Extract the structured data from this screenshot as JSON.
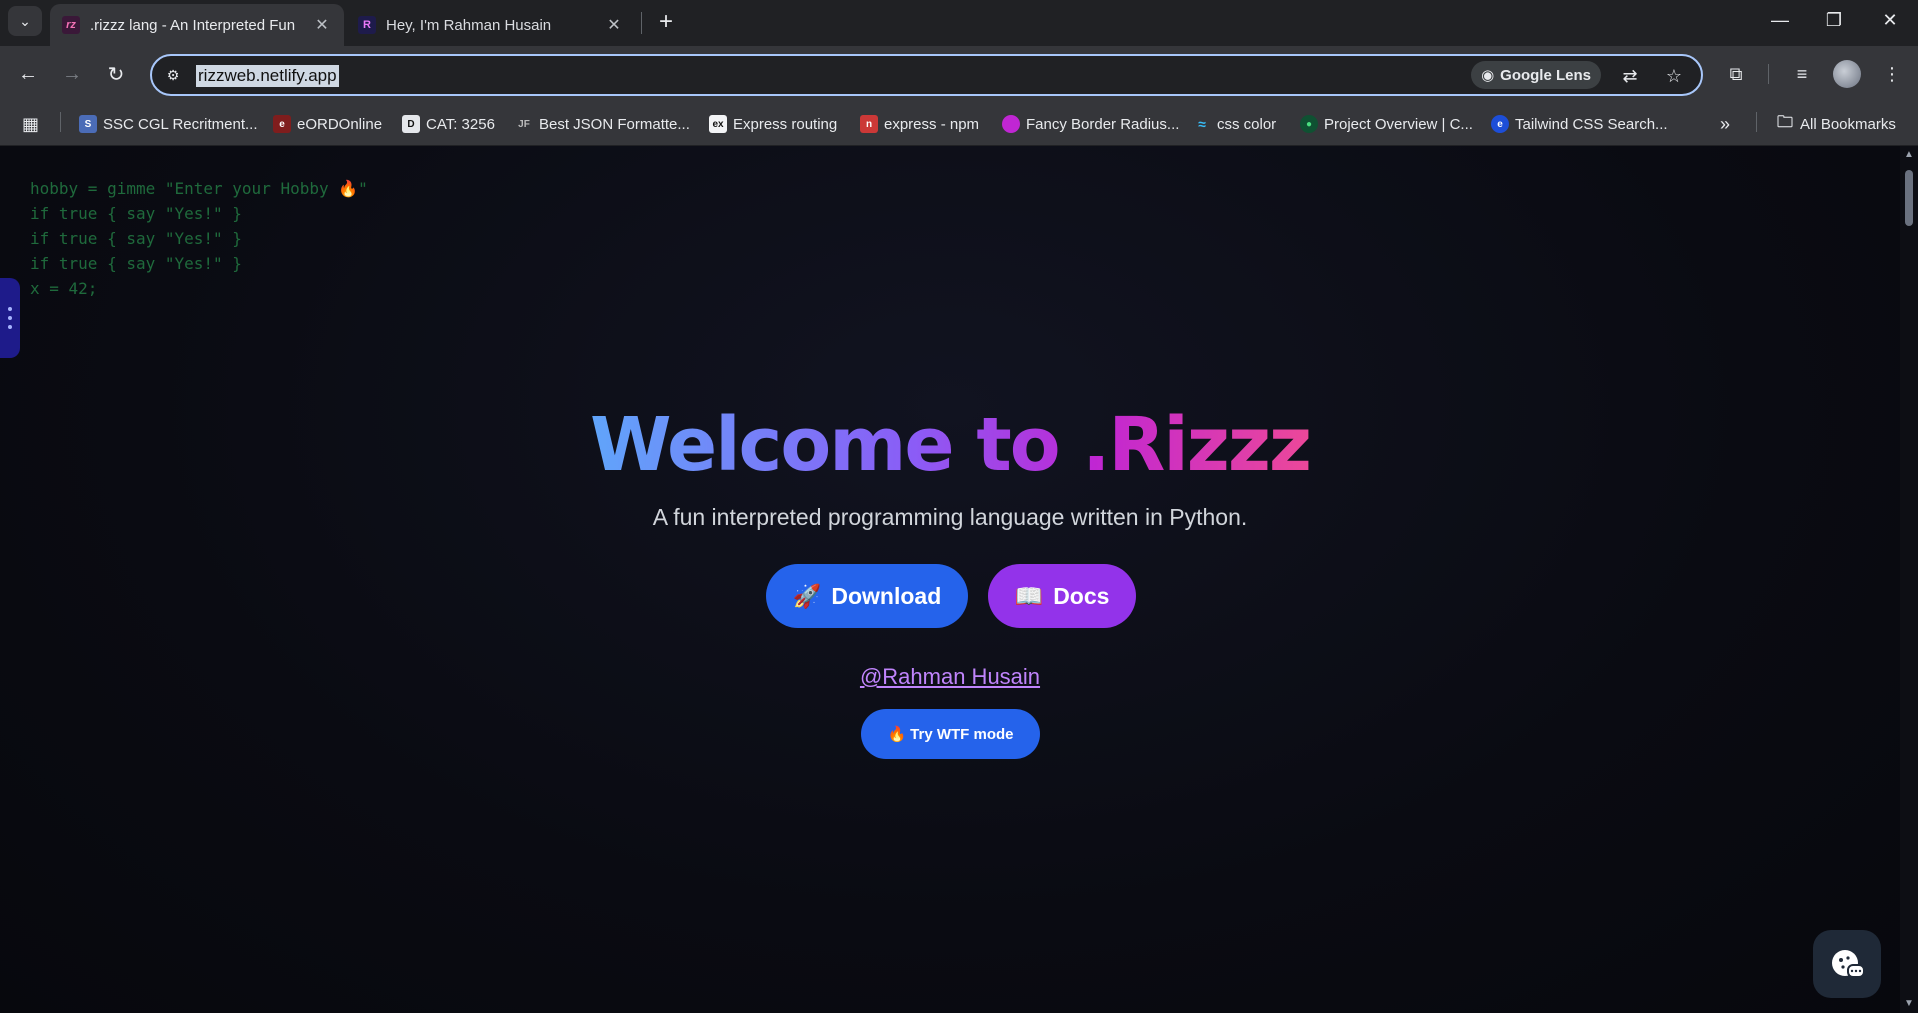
{
  "browser": {
    "tabs": [
      {
        "title": ".rizzz lang - An Interpreted Fun",
        "favicon": "rizz-favicon",
        "active": true
      },
      {
        "title": "Hey, I'm Rahman Husain",
        "favicon": "R",
        "active": false
      }
    ],
    "url": "rizzweb.netlify.app",
    "lens_label": "Google Lens",
    "bookmarks": [
      {
        "label": "SSC CGL Recritment..."
      },
      {
        "label": "eORDOnline"
      },
      {
        "label": "CAT: 3256"
      },
      {
        "label": "Best JSON Formatte..."
      },
      {
        "label": "Express routing"
      },
      {
        "label": "express - npm"
      },
      {
        "label": "Fancy Border Radius..."
      },
      {
        "label": "css color"
      },
      {
        "label": "Project Overview | C..."
      },
      {
        "label": "Tailwind CSS Search..."
      }
    ],
    "all_bookmarks_label": "All Bookmarks"
  },
  "page": {
    "code_lines": [
      "hobby = gimme \"Enter your Hobby 🔥\"",
      "if true { say \"Yes!\" }",
      "if true { say \"Yes!\" }",
      "if true { say \"Yes!\" }",
      "x = 42;"
    ],
    "title": "Welcome to .Rizzz",
    "subtitle": "A fun interpreted programming language written in Python.",
    "download_label": "Download",
    "docs_label": "Docs",
    "author_link": "@Rahman Husain",
    "wtf_label": "Try WTF mode"
  },
  "colors": {
    "accent_blue": "#2563eb",
    "accent_purple": "#9333ea",
    "link": "#c084fc",
    "code_green": "#1f6a3c"
  }
}
